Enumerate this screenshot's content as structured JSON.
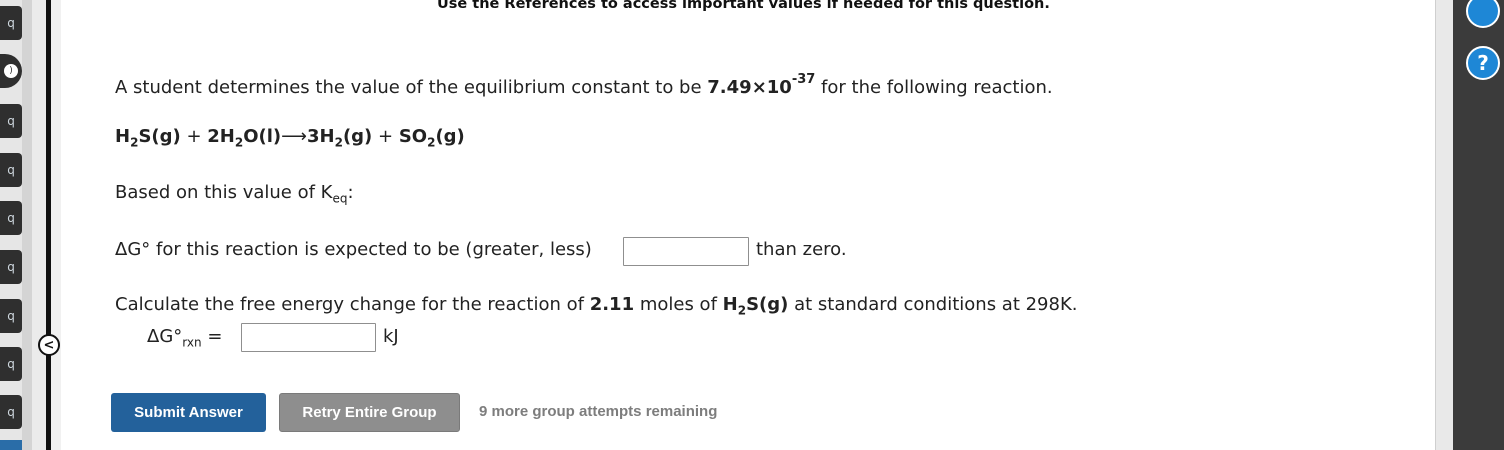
{
  "sidebar": {
    "tabs": [
      {
        "label": "q"
      },
      {
        "label": ")"
      },
      {
        "label": "q"
      },
      {
        "label": "q"
      },
      {
        "label": "q"
      },
      {
        "label": "q"
      },
      {
        "label": "q"
      },
      {
        "label": "q"
      },
      {
        "label": "q"
      }
    ],
    "collapse_icon": "chevron-left-icon",
    "collapse_glyph": "<"
  },
  "header": {
    "references_note": "Use the References to access important values if needed for this question."
  },
  "question": {
    "intro_prefix": "A student determines the value of the equilibrium constant to be ",
    "k_mantissa": "7.49×10",
    "k_exponent": "-37",
    "intro_suffix": " for the following reaction.",
    "equation": {
      "r1": "H",
      "r1_sub": "2",
      "r1_rest": "S(g)",
      "plus1": " + ",
      "r2": "2H",
      "r2_sub": "2",
      "r2_rest": "O(l)",
      "arrow": "⟶",
      "p1": "3H",
      "p1_sub": "2",
      "p1_rest": "(g)",
      "plus2": " + ",
      "p2": "SO",
      "p2_sub": "2",
      "p2_rest": "(g)"
    },
    "based_prefix": "Based on this value of K",
    "based_sub": "eq",
    "based_suffix": ":",
    "dg_prompt": "ΔG° for this reaction is expected to be (greater, less)",
    "dg_value": "",
    "dg_suffix": "than zero.",
    "calc_prefix": "Calculate the free energy change for the reaction of ",
    "calc_moles": "2.11",
    "calc_mid": " moles of ",
    "calc_species": "H",
    "calc_species_sub": "2",
    "calc_species_rest": "S(g)",
    "calc_suffix": " at standard conditions at 298K.",
    "calc_label": "ΔG°",
    "calc_label_sub": "rxn",
    "calc_eq": " =",
    "calc_value": "",
    "calc_unit": "kJ"
  },
  "actions": {
    "submit_label": "Submit Answer",
    "retry_label": "Retry Entire Group",
    "attempts_text": "9 more group attempts remaining"
  },
  "right_toolbar": {
    "icons": [
      "refresh-icon",
      "help-icon"
    ],
    "help_glyph": "?"
  },
  "colors": {
    "submit": "#23619b",
    "retry": "#8e8e8e",
    "help_icon": "#1e87d6"
  }
}
